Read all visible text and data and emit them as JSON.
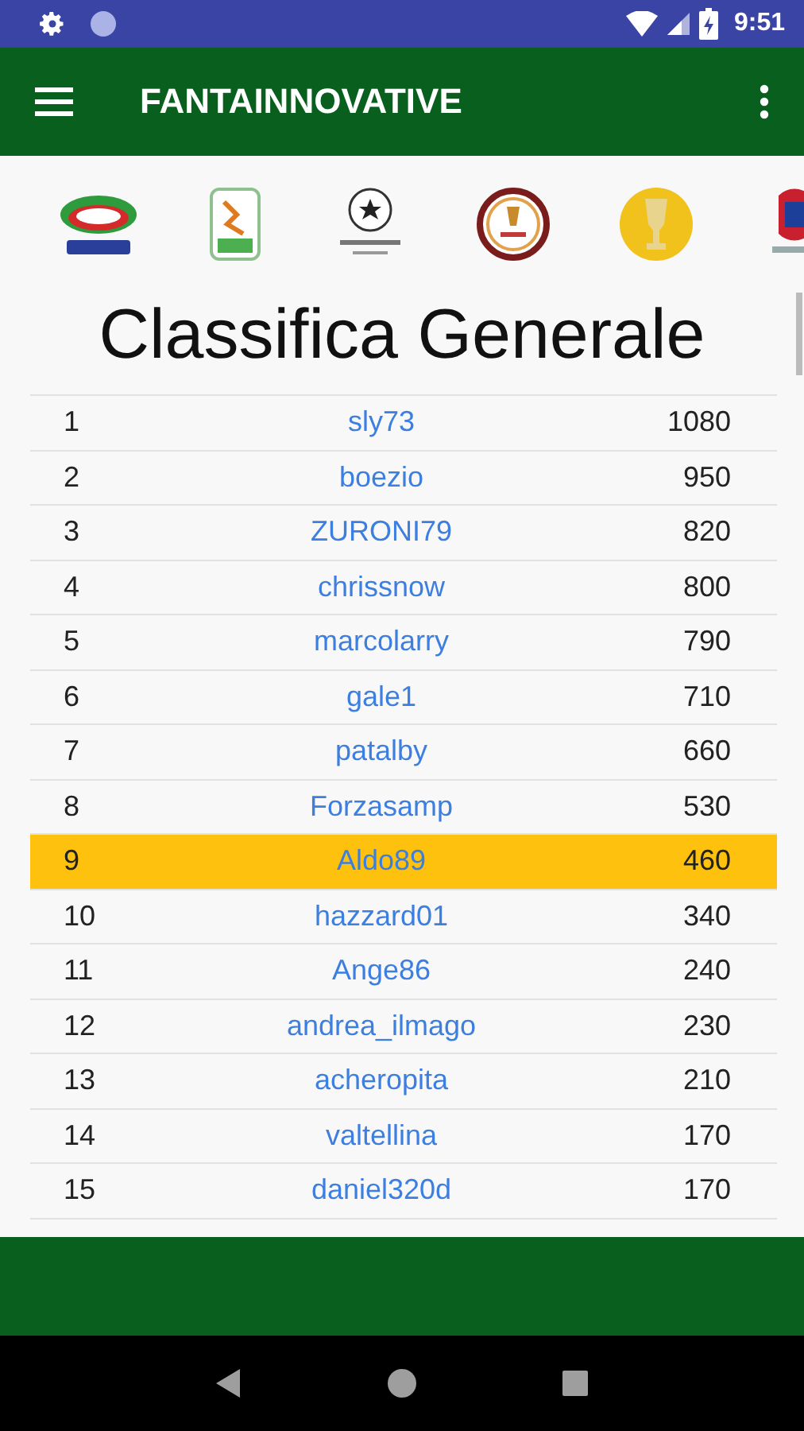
{
  "status_bar": {
    "time": "9:51"
  },
  "toolbar": {
    "title": "FANTAINNOVATIVE"
  },
  "page": {
    "title": "Classifica Generale"
  },
  "table": {
    "rows": [
      {
        "rank": "1",
        "name": "sly73",
        "points": "1080",
        "selected": false
      },
      {
        "rank": "2",
        "name": "boezio",
        "points": "950",
        "selected": false
      },
      {
        "rank": "3",
        "name": "ZURONI79",
        "points": "820",
        "selected": false
      },
      {
        "rank": "4",
        "name": "chrissnow",
        "points": "800",
        "selected": false
      },
      {
        "rank": "5",
        "name": "marcolarry",
        "points": "790",
        "selected": false
      },
      {
        "rank": "6",
        "name": "gale1",
        "points": "710",
        "selected": false
      },
      {
        "rank": "7",
        "name": "patalby",
        "points": "660",
        "selected": false
      },
      {
        "rank": "8",
        "name": "Forzasamp",
        "points": "530",
        "selected": false
      },
      {
        "rank": "9",
        "name": "Aldo89",
        "points": "460",
        "selected": true
      },
      {
        "rank": "10",
        "name": "hazzard01",
        "points": "340",
        "selected": false
      },
      {
        "rank": "11",
        "name": "Ange86",
        "points": "240",
        "selected": false
      },
      {
        "rank": "12",
        "name": "andrea_ilmago",
        "points": "230",
        "selected": false
      },
      {
        "rank": "13",
        "name": "acheropita",
        "points": "210",
        "selected": false
      },
      {
        "rank": "14",
        "name": "valtellina",
        "points": "170",
        "selected": false
      },
      {
        "rank": "15",
        "name": "daniel320d",
        "points": "170",
        "selected": false
      }
    ]
  }
}
